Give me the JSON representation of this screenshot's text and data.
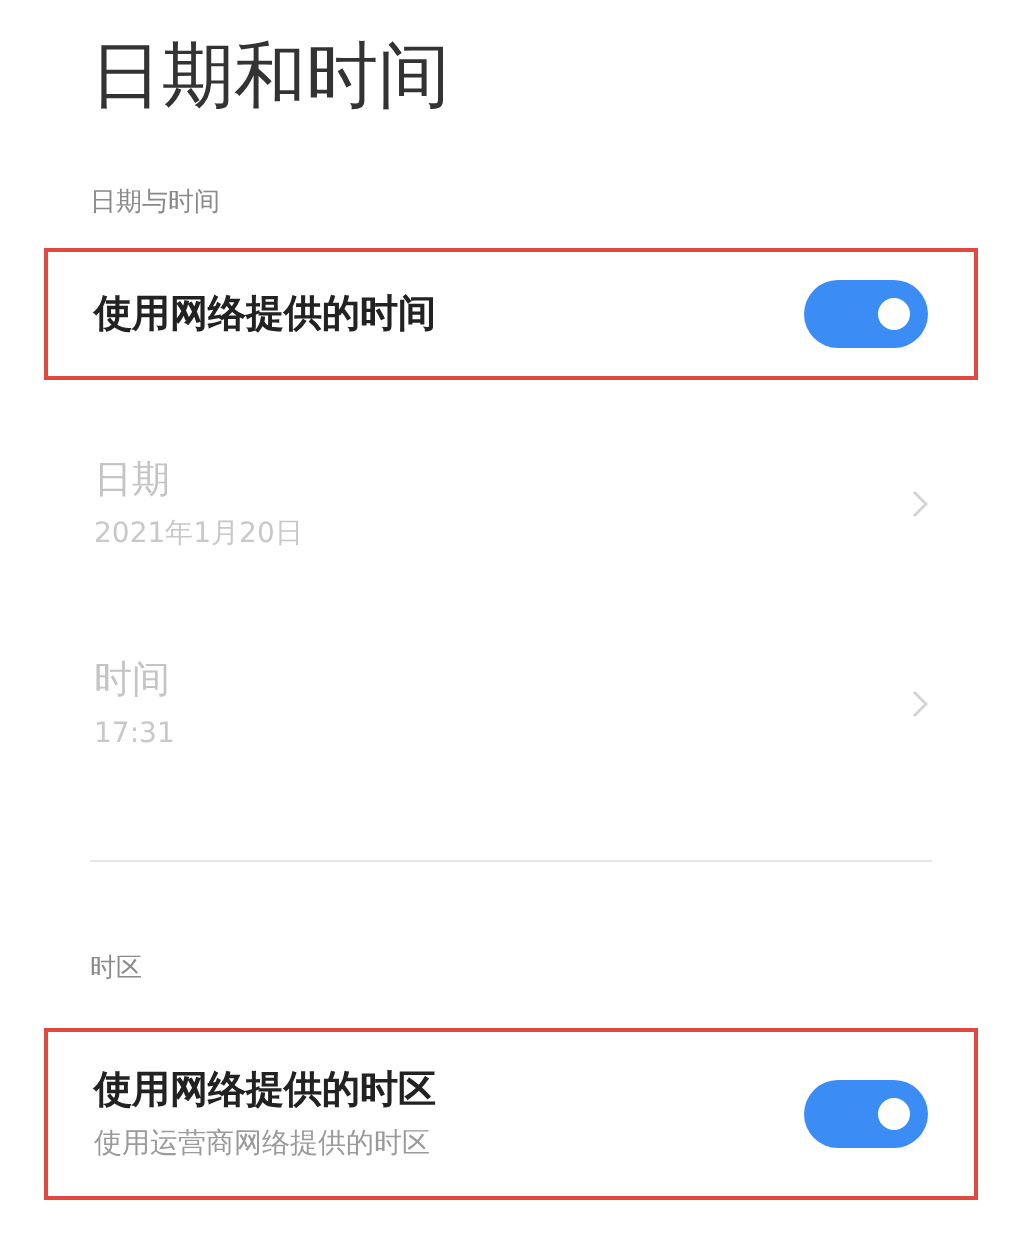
{
  "title": "日期和时间",
  "sections": [
    {
      "header": "日期与时间",
      "rows": [
        {
          "kind": "toggle",
          "label": "使用网络提供的时间",
          "on": true,
          "highlighted": true
        },
        {
          "kind": "link",
          "label": "日期",
          "value": "2021年1月20日",
          "disabled": true,
          "highlighted": false
        },
        {
          "kind": "link",
          "label": "时间",
          "value": "17:31",
          "disabled": true,
          "highlighted": false
        }
      ]
    },
    {
      "header": "时区",
      "rows": [
        {
          "kind": "toggle",
          "label": "使用网络提供的时区",
          "value": "使用运营商网络提供的时区",
          "on": true,
          "highlighted": true
        }
      ]
    }
  ]
}
